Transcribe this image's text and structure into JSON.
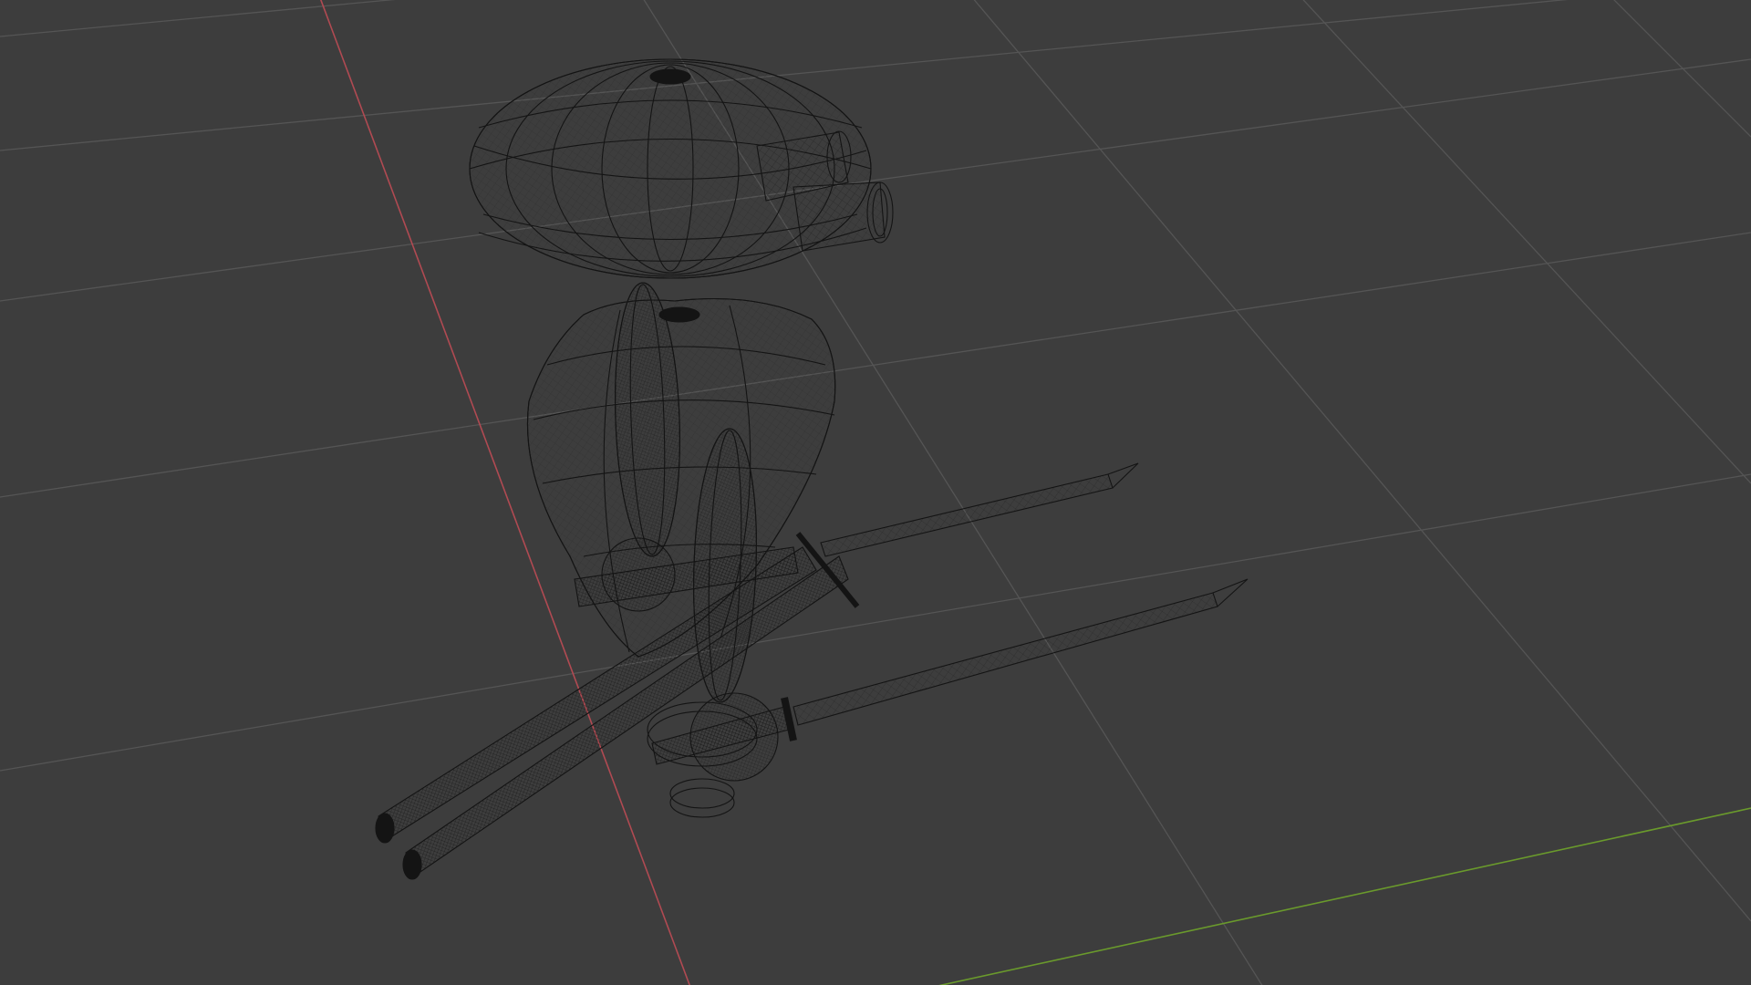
{
  "viewport": {
    "mode": "wireframe",
    "background_color": "#3d3d3d",
    "grid_color": "#545454",
    "axis_x_color": "#b04a52",
    "axis_y_color": "#6a9a2c",
    "wire_color": "#141414"
  }
}
